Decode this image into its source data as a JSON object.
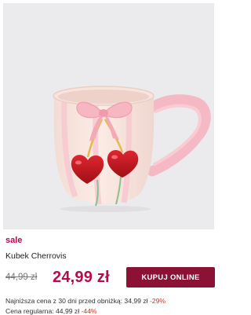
{
  "product": {
    "badge": "sale",
    "name": "Kubek Cherrovis",
    "old_price": "44,99 zł",
    "price": "24,99 zł",
    "buy_label": "KUPUJ ONLINE"
  },
  "price_info": {
    "lowest_label": "Najniższa cena z 30 dni przed obniżką: 34,99 zł",
    "lowest_pct": "-29%",
    "regular_label": "Cena regularna: 44,99 zł",
    "regular_pct": "-44%"
  },
  "colors": {
    "accent": "#b40d4f",
    "button": "#8b1235",
    "image_bg": "#ebebed"
  },
  "image": {
    "subject": "mug-with-bow-and-cherries"
  }
}
